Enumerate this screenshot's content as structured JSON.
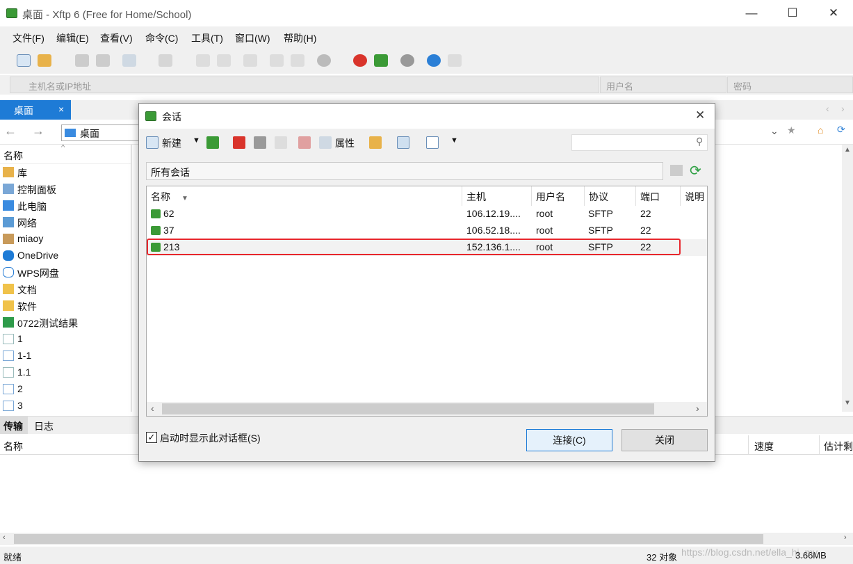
{
  "window": {
    "title": "桌面 - Xftp 6 (Free for Home/School)",
    "minimize": "—",
    "maximize": "☐",
    "close": "✕"
  },
  "menu": [
    "文件(F)",
    "编辑(E)",
    "查看(V)",
    "命令(C)",
    "工具(T)",
    "窗口(W)",
    "帮助(H)"
  ],
  "address": {
    "host_placeholder": "主机名或IP地址",
    "user_placeholder": "用户名",
    "password_placeholder": "密码"
  },
  "tab": {
    "label": "桌面",
    "close": "×"
  },
  "nav": {
    "location": "桌面"
  },
  "left_pane": {
    "column": "名称",
    "items": [
      {
        "label": "库",
        "icon": "library-icon"
      },
      {
        "label": "控制面板",
        "icon": "control-panel-icon"
      },
      {
        "label": "此电脑",
        "icon": "computer-icon"
      },
      {
        "label": "网络",
        "icon": "network-icon"
      },
      {
        "label": "miaoy",
        "icon": "user-icon"
      },
      {
        "label": "OneDrive",
        "icon": "cloud-icon"
      },
      {
        "label": "WPS网盘",
        "icon": "cloud-icon"
      },
      {
        "label": "文档",
        "icon": "folder-icon"
      },
      {
        "label": "软件",
        "icon": "folder-icon"
      },
      {
        "label": "0722测试结果",
        "icon": "spreadsheet-icon"
      },
      {
        "label": "1",
        "icon": "file-icon"
      },
      {
        "label": "1-1",
        "icon": "file-icon"
      },
      {
        "label": "1.1",
        "icon": "file-icon"
      },
      {
        "label": "2",
        "icon": "file-icon"
      },
      {
        "label": "3",
        "icon": "file-icon"
      }
    ]
  },
  "bottom": {
    "tabs": [
      "传输",
      "日志"
    ],
    "col_name": "名称",
    "col_speed": "速度",
    "col_eta": "估计剩"
  },
  "status": {
    "left": "就绪",
    "objects": "32 对象",
    "size": "3.66MB",
    "watermark": "https://blog.csdn.net/ella_hi_my"
  },
  "dialog": {
    "title": "会话",
    "close": "✕",
    "toolbar": {
      "new": "新建",
      "properties": "属性"
    },
    "path": "所有会话",
    "columns": [
      "名称",
      "主机",
      "用户名",
      "协议",
      "端口",
      "说明"
    ],
    "sessions": [
      {
        "name": "62",
        "host": "106.12.19....",
        "user": "root",
        "protocol": "SFTP",
        "port": "22"
      },
      {
        "name": "37",
        "host": "106.52.18....",
        "user": "root",
        "protocol": "SFTP",
        "port": "22"
      },
      {
        "name": "213",
        "host": "152.136.1....",
        "user": "root",
        "protocol": "SFTP",
        "port": "22"
      }
    ],
    "show_on_startup": "启动时显示此对话框(S)",
    "connect": "连接(C)",
    "close_button": "关闭"
  },
  "colors": {
    "accent": "#1e7bd6",
    "session_icon": "#3b9a36",
    "highlight": "#e8262c"
  }
}
